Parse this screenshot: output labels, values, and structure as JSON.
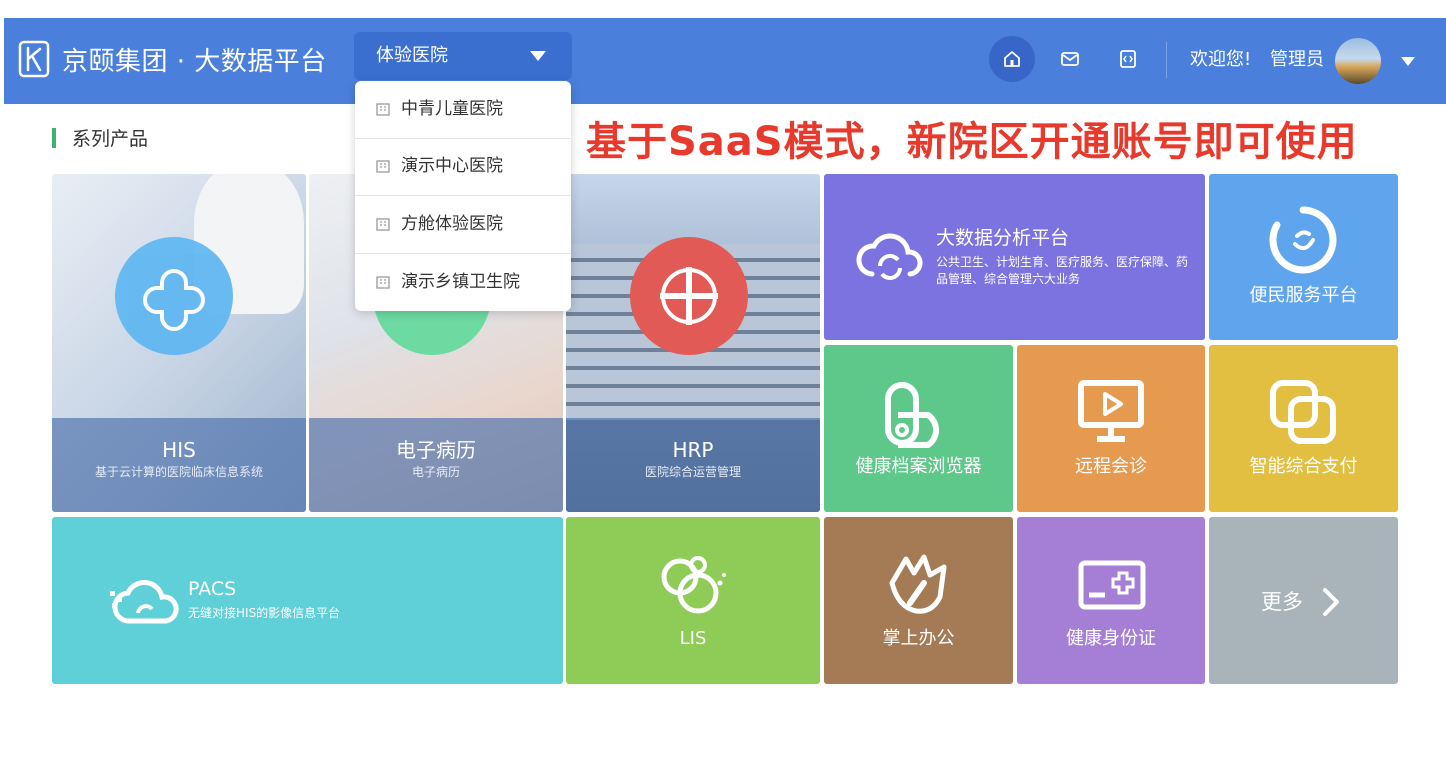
{
  "header": {
    "brand": "京颐集团 · 大数据平台",
    "hospital_selected": "体验医院",
    "welcome": "欢迎您!",
    "username": "管理员",
    "icons": [
      "home-icon",
      "mail-icon",
      "code-icon"
    ]
  },
  "dropdown": {
    "items": [
      {
        "label": "中青儿童医院"
      },
      {
        "label": "演示中心医院"
      },
      {
        "label": "方舱体验医院"
      },
      {
        "label": "演示乡镇卫生院"
      }
    ]
  },
  "section": {
    "title": "系列产品"
  },
  "banner": "基于SaaS模式，新院区开通账号即可使用",
  "tiles": {
    "his": {
      "title": "HIS",
      "subtitle": "基于云计算的医院临床信息系统"
    },
    "emr": {
      "title": "电子病历",
      "subtitle": "电子病历"
    },
    "hrp": {
      "title": "HRP",
      "subtitle": "医院综合运营管理"
    },
    "bigdata": {
      "title": "大数据分析平台",
      "desc": "公共卫生、计划生育、医疗服务、医疗保障、药品管理、综合管理六大业务"
    },
    "service": {
      "label": "便民服务平台"
    },
    "health_record": {
      "label": "健康档案浏览器"
    },
    "remote": {
      "label": "远程会诊"
    },
    "payment": {
      "label": "智能综合支付"
    },
    "pacs": {
      "title": "PACS",
      "desc": "无缝对接HIS的影像信息平台"
    },
    "lis": {
      "label": "LIS"
    },
    "office": {
      "label": "掌上办公"
    },
    "health_id": {
      "label": "健康身份证"
    },
    "more": {
      "label": "更多"
    }
  },
  "colors": {
    "header": "#4a7fdc",
    "bigdata": "#7b73e0",
    "service": "#5fa5ee",
    "health_record": "#5ec88a",
    "remote": "#e69a4f",
    "payment": "#e2bf40",
    "pacs": "#5fcfd8",
    "lis": "#8fcc57",
    "office": "#a47b55",
    "health_id": "#a57fd6",
    "more": "#a9b3ba",
    "banner": "#e83a2c"
  }
}
